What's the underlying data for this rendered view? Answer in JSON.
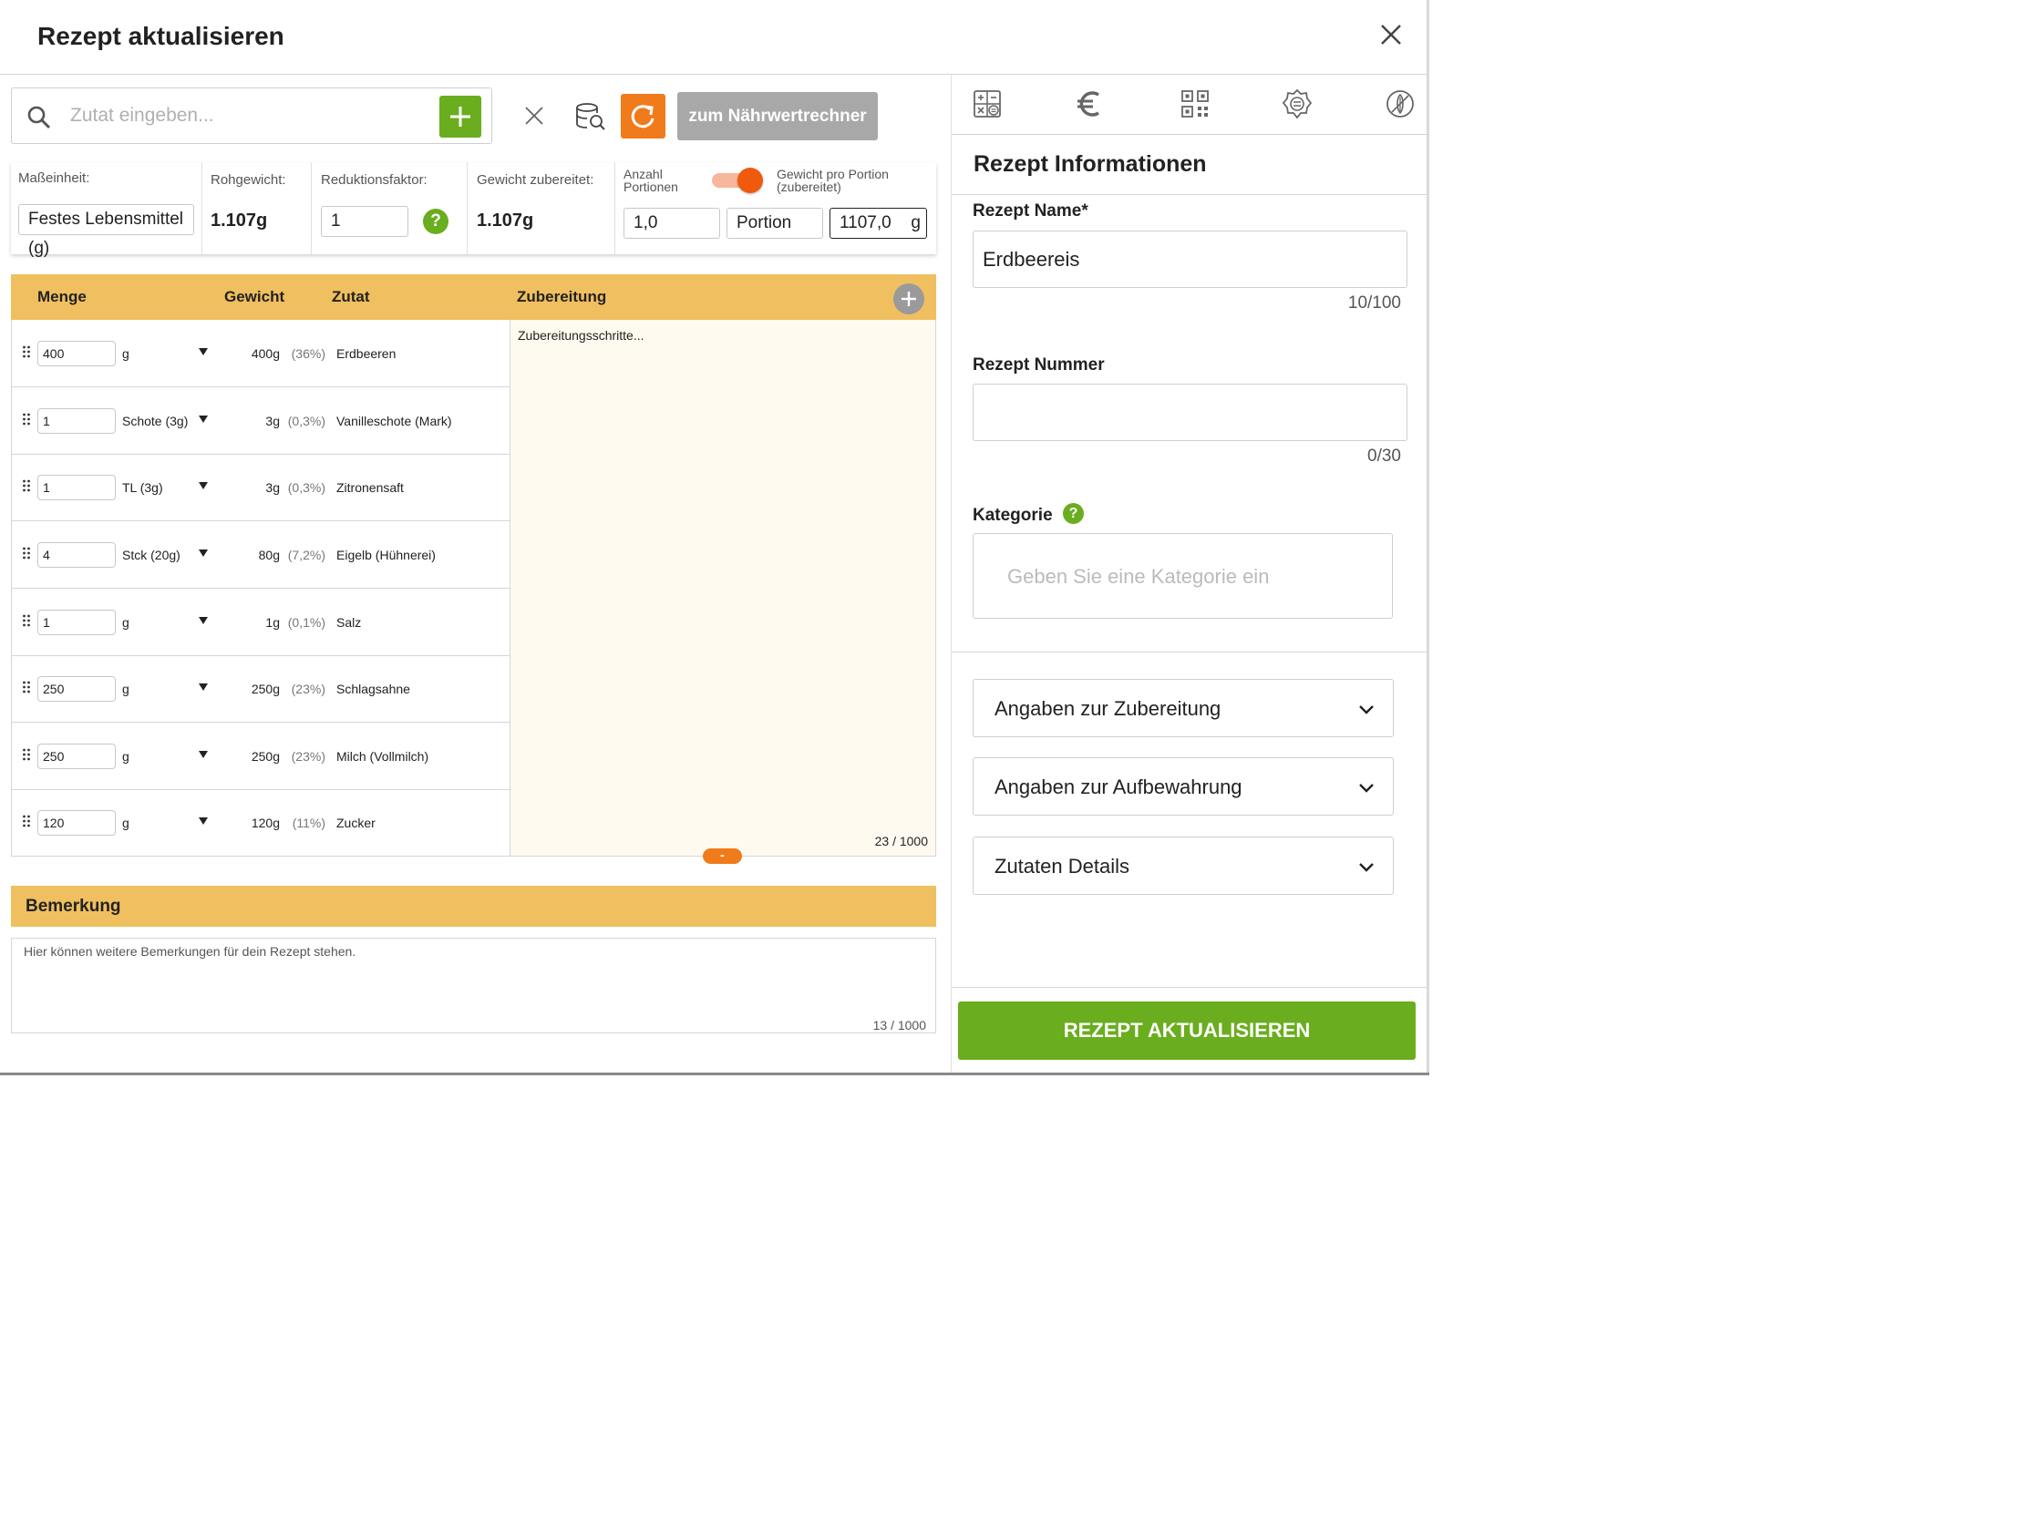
{
  "header": {
    "title": "Rezept aktualisieren"
  },
  "search": {
    "placeholder": "Zutat eingeben...",
    "calc_button": "zum Nährwertrechner"
  },
  "info": {
    "unit_label": "Maßeinheit:",
    "unit_value": "Festes Lebensmittel (g)",
    "raw_weight_label": "Rohgewicht:",
    "raw_weight_value": "1.107g",
    "reduction_label": "Reduktionsfaktor:",
    "reduction_value": "1",
    "prepared_weight_label": "Gewicht zubereitet:",
    "prepared_weight_value": "1.107g",
    "portions_label": "Anzahl Portionen",
    "per_portion_label": "Gewicht pro Portion (zubereitet)",
    "portions_value": "1,0",
    "portion_unit": "Portion",
    "portion_weight": "1107,0",
    "portion_weight_unit": "g"
  },
  "table": {
    "headers": {
      "amount": "Menge",
      "weight": "Gewicht",
      "ingredient": "Zutat",
      "preparation": "Zubereitung"
    },
    "rows": [
      {
        "qty": "400",
        "unit": "g",
        "weight": "400g",
        "pct": "(36%)",
        "name": "Erdbeeren"
      },
      {
        "qty": "1",
        "unit": "Schote (3g)",
        "weight": "3g",
        "pct": "(0,3%)",
        "name": "Vanilleschote (Mark)"
      },
      {
        "qty": "1",
        "unit": "TL (3g)",
        "weight": "3g",
        "pct": "(0,3%)",
        "name": "Zitronensaft"
      },
      {
        "qty": "4",
        "unit": "Stck (20g)",
        "weight": "80g",
        "pct": "(7,2%)",
        "name": "Eigelb (Hühnerei)"
      },
      {
        "qty": "1",
        "unit": "g",
        "weight": "1g",
        "pct": "(0,1%)",
        "name": "Salz"
      },
      {
        "qty": "250",
        "unit": "g",
        "weight": "250g",
        "pct": "(23%)",
        "name": "Schlagsahne"
      },
      {
        "qty": "250",
        "unit": "g",
        "weight": "250g",
        "pct": "(23%)",
        "name": "Milch (Vollmilch)"
      },
      {
        "qty": "120",
        "unit": "g",
        "weight": "120g",
        "pct": "(11%)",
        "name": "Zucker"
      }
    ],
    "prep_placeholder": "Zubereitungsschritte...",
    "prep_count": "23 / 1000",
    "collapse_label": "-"
  },
  "note": {
    "title": "Bemerkung",
    "placeholder": "Hier können weitere Bemerkungen für dein Rezept stehen.",
    "count": "13 / 1000"
  },
  "side": {
    "title": "Rezept Informationen",
    "name_label": "Rezept Name*",
    "name_value": "Erdbeereis",
    "name_counter": "10/100",
    "number_label": "Rezept Nummer",
    "number_value": "",
    "number_counter": "0/30",
    "category_label": "Kategorie",
    "category_placeholder": "Geben Sie eine Kategorie ein",
    "accordions": [
      "Angaben zur Zubereitung",
      "Angaben zur Aufbewahrung",
      "Zutaten Details"
    ],
    "update_button": "REZEPT AKTUALISIEREN",
    "tabs": [
      "calculator-icon",
      "euro-icon",
      "qr-code-icon",
      "allergen-icon",
      "nutrition-icon"
    ]
  },
  "colors": {
    "accent_orange": "#f07b1a",
    "brand_green": "#6aad1e",
    "table_header": "#f0bf5f"
  }
}
